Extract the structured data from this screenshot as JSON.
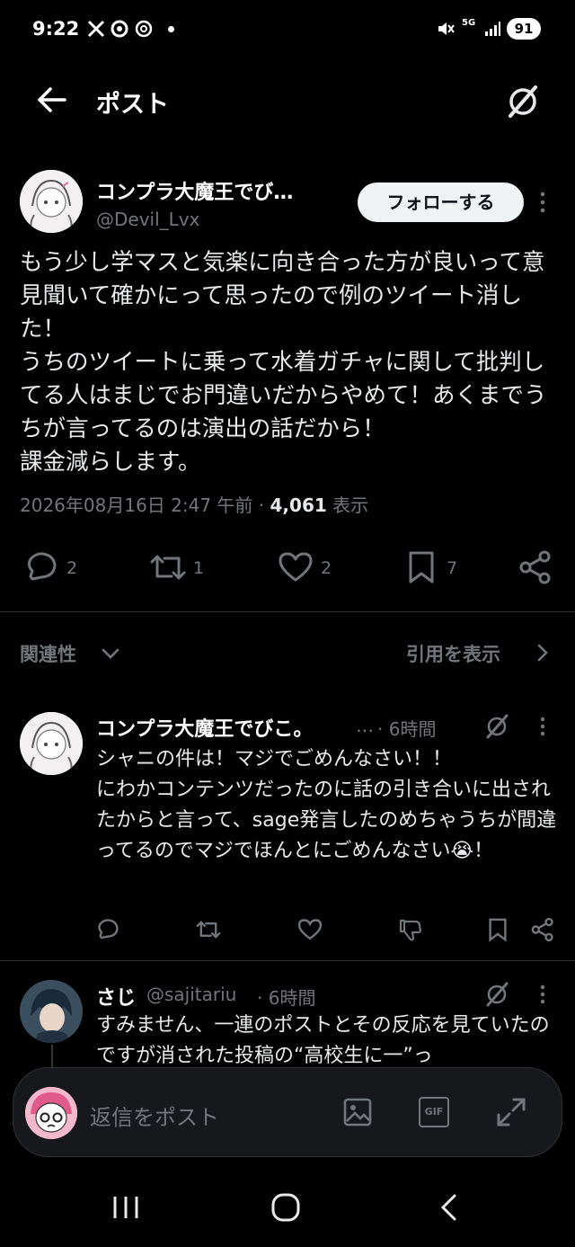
{
  "status_bar": {
    "time": "9:22",
    "battery": "91",
    "network": "5G"
  },
  "header": {
    "title": "ポスト"
  },
  "post": {
    "author_name": "コンプラ大魔王でび…",
    "author_handle": "@Devil_Lvx",
    "follow_label": "フォローする",
    "text": "もう少し学マスと気楽に向き合った方が良いって意見聞いて確かにって思ったので例のツイート消した！\nうちのツイートに乗って水着ガチャに関して批判してる人はまじでお門違いだからやめて！あくまでうちが言ってるのは演出の話だから！\n課金減らします。",
    "timestamp": "2026年08月16日 2:47 午前",
    "separator": "·",
    "views_count": "4,061",
    "views_label": "表示",
    "actions": {
      "replies": "2",
      "reposts": "1",
      "likes": "2",
      "bookmarks": "7"
    }
  },
  "related": {
    "label": "関連性",
    "quotes_label": "引用を表示"
  },
  "replies": [
    {
      "name": "コンプラ大魔王でびこ。",
      "ellipsis": "…",
      "time": "· 6時間",
      "text": "シャニの件は！マジでごめんなさい！！\nにわかコンテンツだったのに話の引き合いに出されたからと言って、sage発言したのめちゃうちが間違ってるのでマジでほんとにごめんなさい😭！"
    },
    {
      "name": "さじ",
      "handle": "@sajitariu",
      "time": "· 6時間",
      "text": "すみません、一連のポストとその反応を見ていたのですが消された投稿の“高校生に一”っ"
    }
  ],
  "reply_bar": {
    "placeholder": "返信をポスト",
    "gif_label": "GIF"
  },
  "colors": {
    "background": "#000000",
    "text": "#e7e9ea",
    "muted": "#71767b",
    "divider": "#2f3336",
    "follow_bg": "#eff3f4"
  }
}
